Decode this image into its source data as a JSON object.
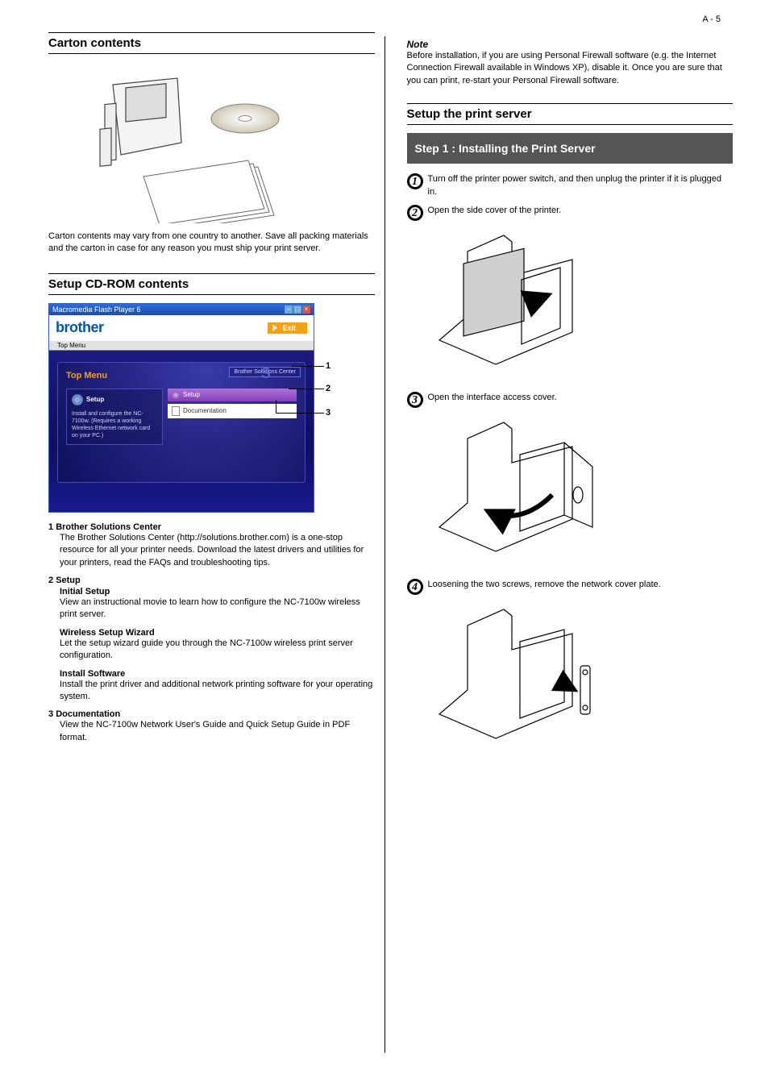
{
  "page_number": "A - 5",
  "left": {
    "section_title": "Carton contents",
    "para1": "Carton contents may vary from one country to another. Save all packing materials and the carton in case for any reason you must ship your print server.",
    "sub_title": "Setup CD-ROM contents",
    "flash": {
      "titlebar": "Macromedia Flash Player 6",
      "brother": "brother",
      "exit": "Exit",
      "strip": "Top Menu",
      "topmenu": "Top Menu",
      "bsc": "Brother Solutions Center",
      "panel_setup": "Setup",
      "panel_left_text": "Install and configure the NC-7100w. (Requires a working Wireless Ethernet network card on your PC.)",
      "menu_setup": "Setup",
      "menu_doc": "Documentation"
    },
    "callouts": {
      "c1": "1",
      "c2": "2",
      "c3": "3"
    },
    "item1": {
      "num": "1",
      "title": "Brother Solutions Center",
      "p1": "The Brother Solutions Center (http://solutions.brother.com) is a one-stop resource for all your printer needs. Download the latest drivers and utilities for your printers, read the FAQs and troubleshooting tips.",
      "p2_head": "Initial Setup",
      "p2": "View an instructional movie to learn how to configure the NC-7100w wireless print server.",
      "p3_head": "Wireless Setup Wizard",
      "p3": "Let the setup wizard guide you through the NC-7100w wireless print server configuration.",
      "p4_head": "Install Software",
      "p4": "Install the print driver and additional network printing software for your operating system."
    },
    "item2": {
      "num": "2",
      "title": "Setup"
    },
    "item3": {
      "num": "3",
      "title": "Documentation",
      "p": "View the NC-7100w Network User's Guide and Quick Setup Guide in PDF format."
    }
  },
  "right": {
    "note_head": "Note",
    "note_p": "Before installation, if you are using Personal Firewall software (e.g. the Internet Connection Firewall available in Windows XP), disable it. Once you are sure that you can print, re-start your Personal Firewall software.",
    "sub_title": "Setup the print server",
    "graybar": "Step 1 : Installing the Print Server",
    "step1": "Turn off the printer power switch, and then unplug the printer if it is plugged in.",
    "step2": "Open the side cover of the printer.",
    "step3": "Open the interface access cover.",
    "step4": "Loosening the two screws, remove the network cover plate."
  }
}
